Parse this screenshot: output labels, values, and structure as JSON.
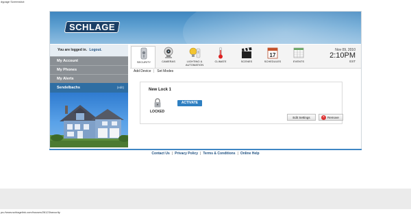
{
  "page_caption": "dypage Screenshot",
  "status_url": "ps://www.schlagelink.com/houses/26123/security",
  "brand": {
    "logo_text": "SCHLAGE"
  },
  "sidebar": {
    "logged_in_text": "You are logged in.",
    "logout_label": "Logout.",
    "items": [
      {
        "label": "My Account"
      },
      {
        "label": "My Phones"
      },
      {
        "label": "My Alerts"
      }
    ],
    "account": {
      "name": "Sendelbachs",
      "edit_label": "(edit)"
    }
  },
  "toolbar": {
    "tabs": [
      {
        "label": "SECURITY",
        "icon": "lock-device-icon",
        "active": true
      },
      {
        "label": "CAMERAS",
        "icon": "camera-icon",
        "active": false
      },
      {
        "label": "LIGHTING & AUTOMATION",
        "icon": "lightbulb-icon",
        "active": false
      },
      {
        "label": "CLIMATE",
        "icon": "thermometer-icon",
        "active": false
      },
      {
        "label": "SCENES",
        "icon": "clapperboard-icon",
        "active": false
      },
      {
        "label": "SCHEDULES",
        "icon": "calendar-icon",
        "active": false
      },
      {
        "label": "EVENTS",
        "icon": "spreadsheet-icon",
        "active": false
      }
    ],
    "calendar_day": "17",
    "date": "Nov 09, 2010",
    "time": "2:10PM",
    "timezone": "EST"
  },
  "subnav": {
    "add_device": "Add Device",
    "separator": "|",
    "set_modes": "Set Modes"
  },
  "device": {
    "name": "New Lock 1",
    "status": "LOCKED",
    "activate_label": "ACTIVATE",
    "edit_settings_label": "Edit Settings",
    "remove_label": "Remove"
  },
  "footer": {
    "links": [
      {
        "label": "Contact Us"
      },
      {
        "label": "Privacy Policy"
      },
      {
        "label": "Terms & Conditions"
      },
      {
        "label": "Online Help"
      }
    ],
    "separator": "|"
  },
  "colors": {
    "banner": "#4a90c8",
    "nav_gray": "#8a8f94",
    "account_blue": "#2f6ea3",
    "activate_blue": "#2e7fc1",
    "link_blue": "#1d4f80"
  }
}
